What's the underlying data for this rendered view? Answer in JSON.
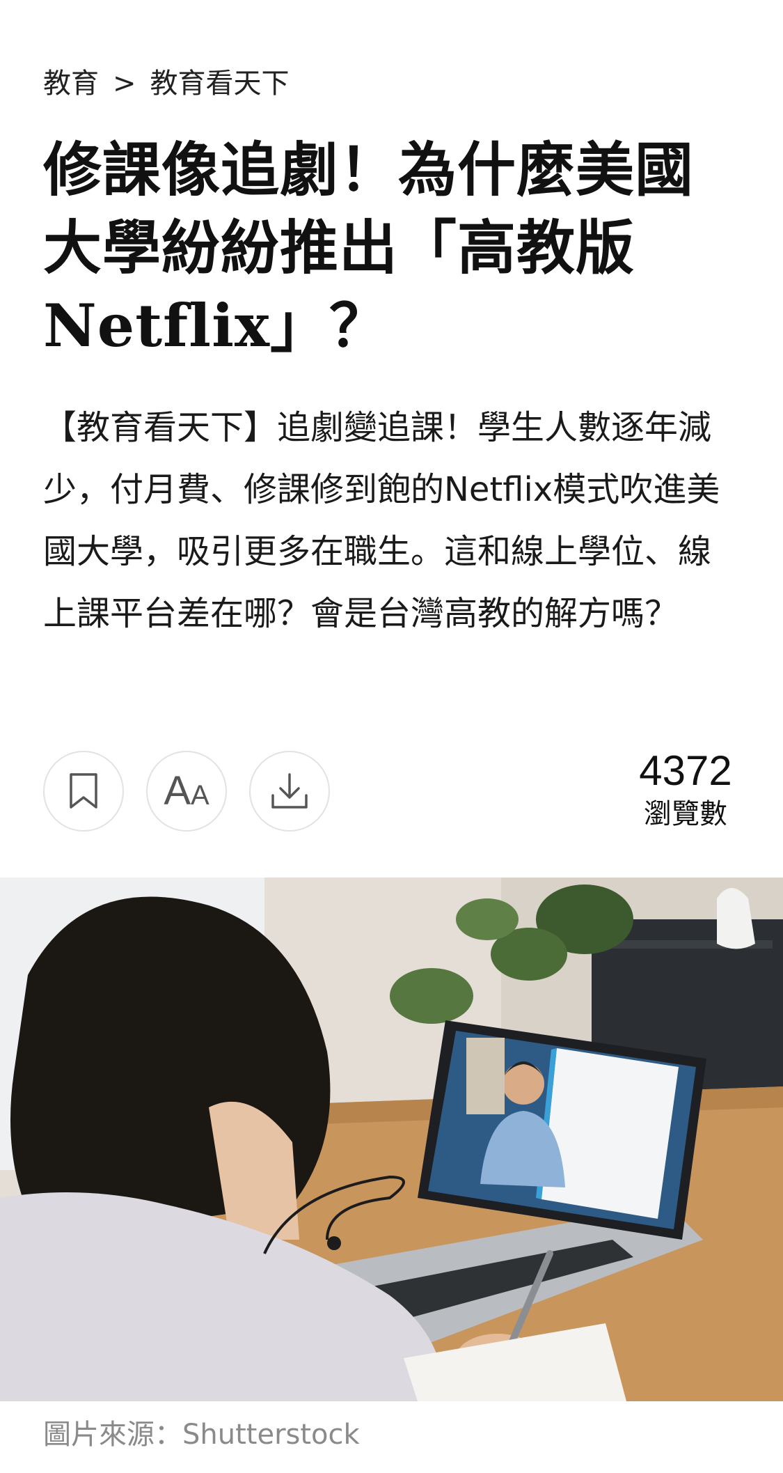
{
  "breadcrumb": {
    "items": [
      "教育",
      "教育看天下"
    ],
    "separator": ">"
  },
  "article": {
    "title": "修課像追劇！為什麼美國大學紛紛推出「高教版Netflix」？",
    "summary": "【教育看天下】追劇變追課！學生人數逐年減少，付月費、修課修到飽的Netflix模式吹進美國大學，吸引更多在職生。這和線上學位、線上課平台差在哪？會是台灣高教的解方嗎？"
  },
  "toolbar": {
    "bookmark_icon": "bookmark-icon",
    "font_size_icon": "font-size-icon",
    "font_size_label_big": "A",
    "font_size_label_small": "A",
    "download_icon": "download-icon"
  },
  "views": {
    "count": "4372",
    "label": "瀏覽數"
  },
  "hero_image": {
    "caption": "圖片來源：Shutterstock"
  },
  "colors": {
    "text": "#1a1a1a",
    "caption": "#8a8a8a",
    "button_border": "#e2e2e2",
    "icon": "#555555"
  }
}
